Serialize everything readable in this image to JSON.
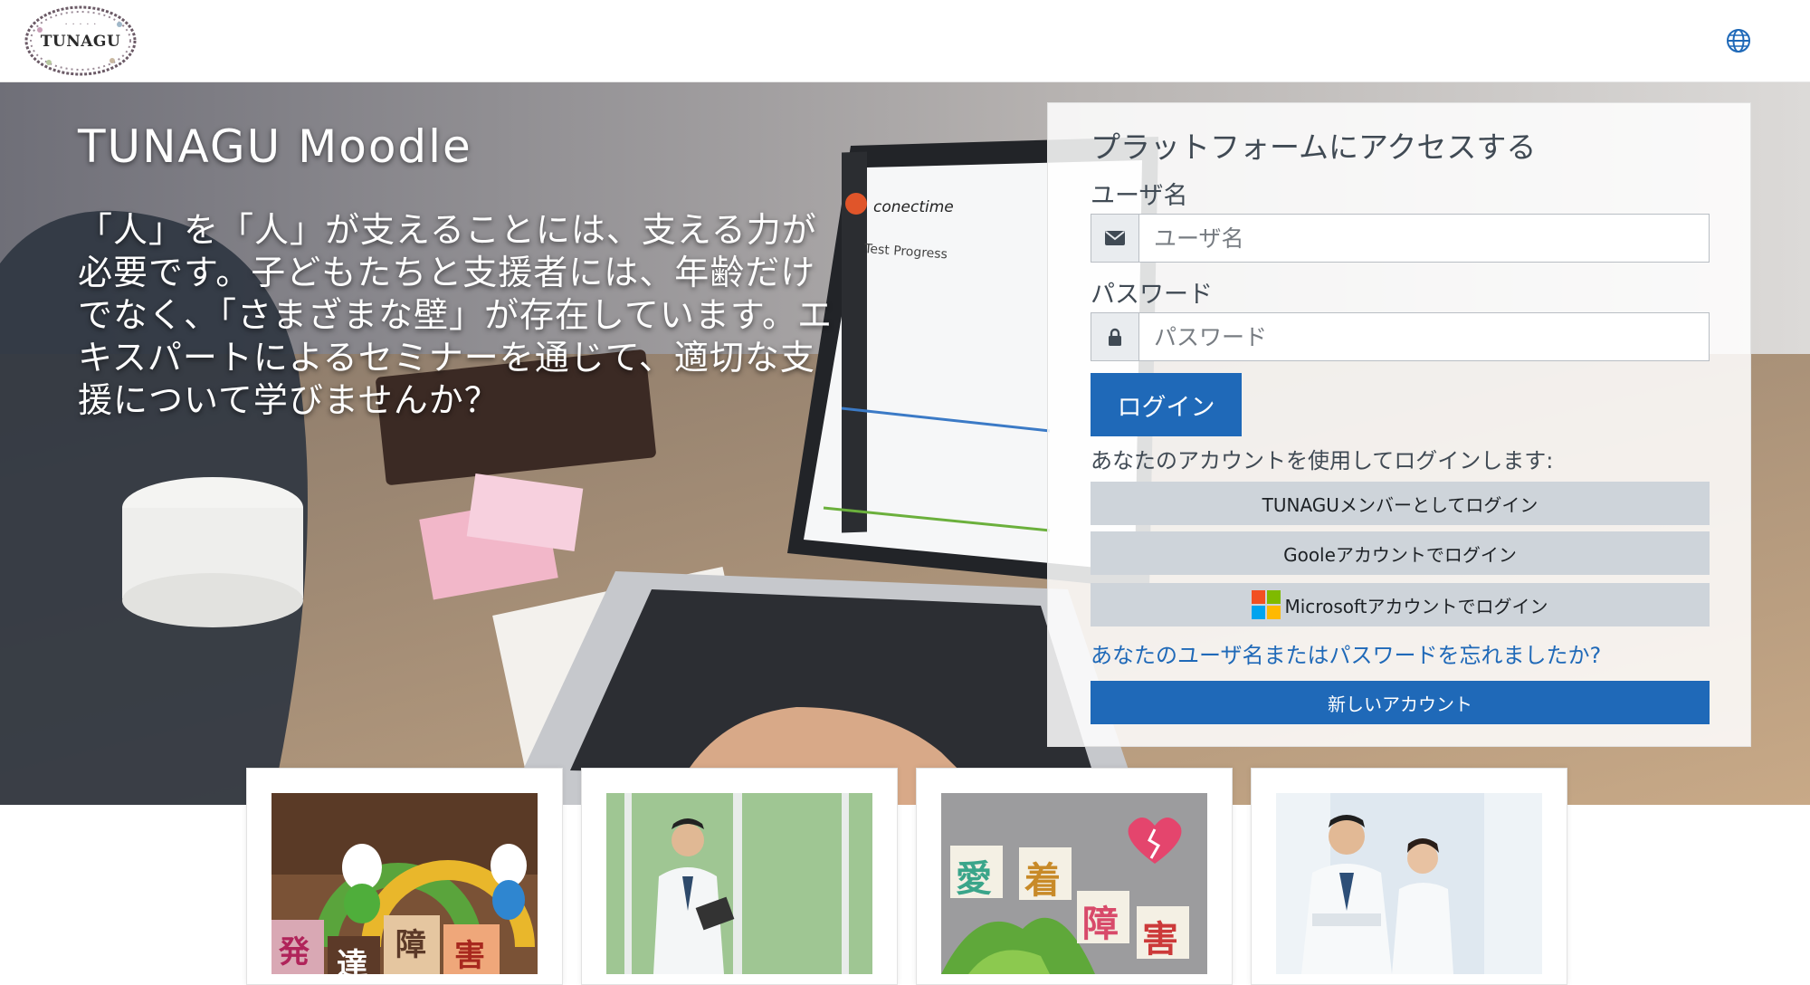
{
  "logo": {
    "text": "TUNAGU"
  },
  "hero": {
    "title": "TUNAGU Moodle",
    "description": "「人」を「人」が支えることには、支える力が必要です。子どもたちと支援者には、年齢だけでなく、「さまざまな壁」が存在しています。エキスパートによるセミナーを通じて、適切な支援について学びませんか？"
  },
  "login": {
    "heading": "プラットフォームにアクセスする",
    "username_label": "ユーザ名",
    "username_placeholder": "ユーザ名",
    "password_label": "パスワード",
    "password_placeholder": "パスワード",
    "login_button": "ログイン",
    "account_note": "あなたのアカウントを使用してログインします:",
    "tunagu_button": "TUNAGUメンバーとしてログイン",
    "google_button": "Gooleアカウントでログイン",
    "microsoft_button": "Microsoftアカウントでログイン",
    "forgot_link": "あなたのユーザ名またはパスワードを忘れましたか?",
    "new_account_button": "新しいアカウント"
  },
  "cards": [
    {
      "tiles": [
        "発",
        "達",
        "障",
        "害"
      ]
    },
    {},
    {
      "tiles": [
        "愛",
        "着",
        "障",
        "害"
      ]
    },
    {}
  ],
  "colors": {
    "primary": "#1f69b8",
    "secondary_button": "#ced4da",
    "text": "#404a54"
  },
  "icons": [
    "globe-icon",
    "envelope-icon",
    "lock-icon",
    "microsoft-icon"
  ]
}
